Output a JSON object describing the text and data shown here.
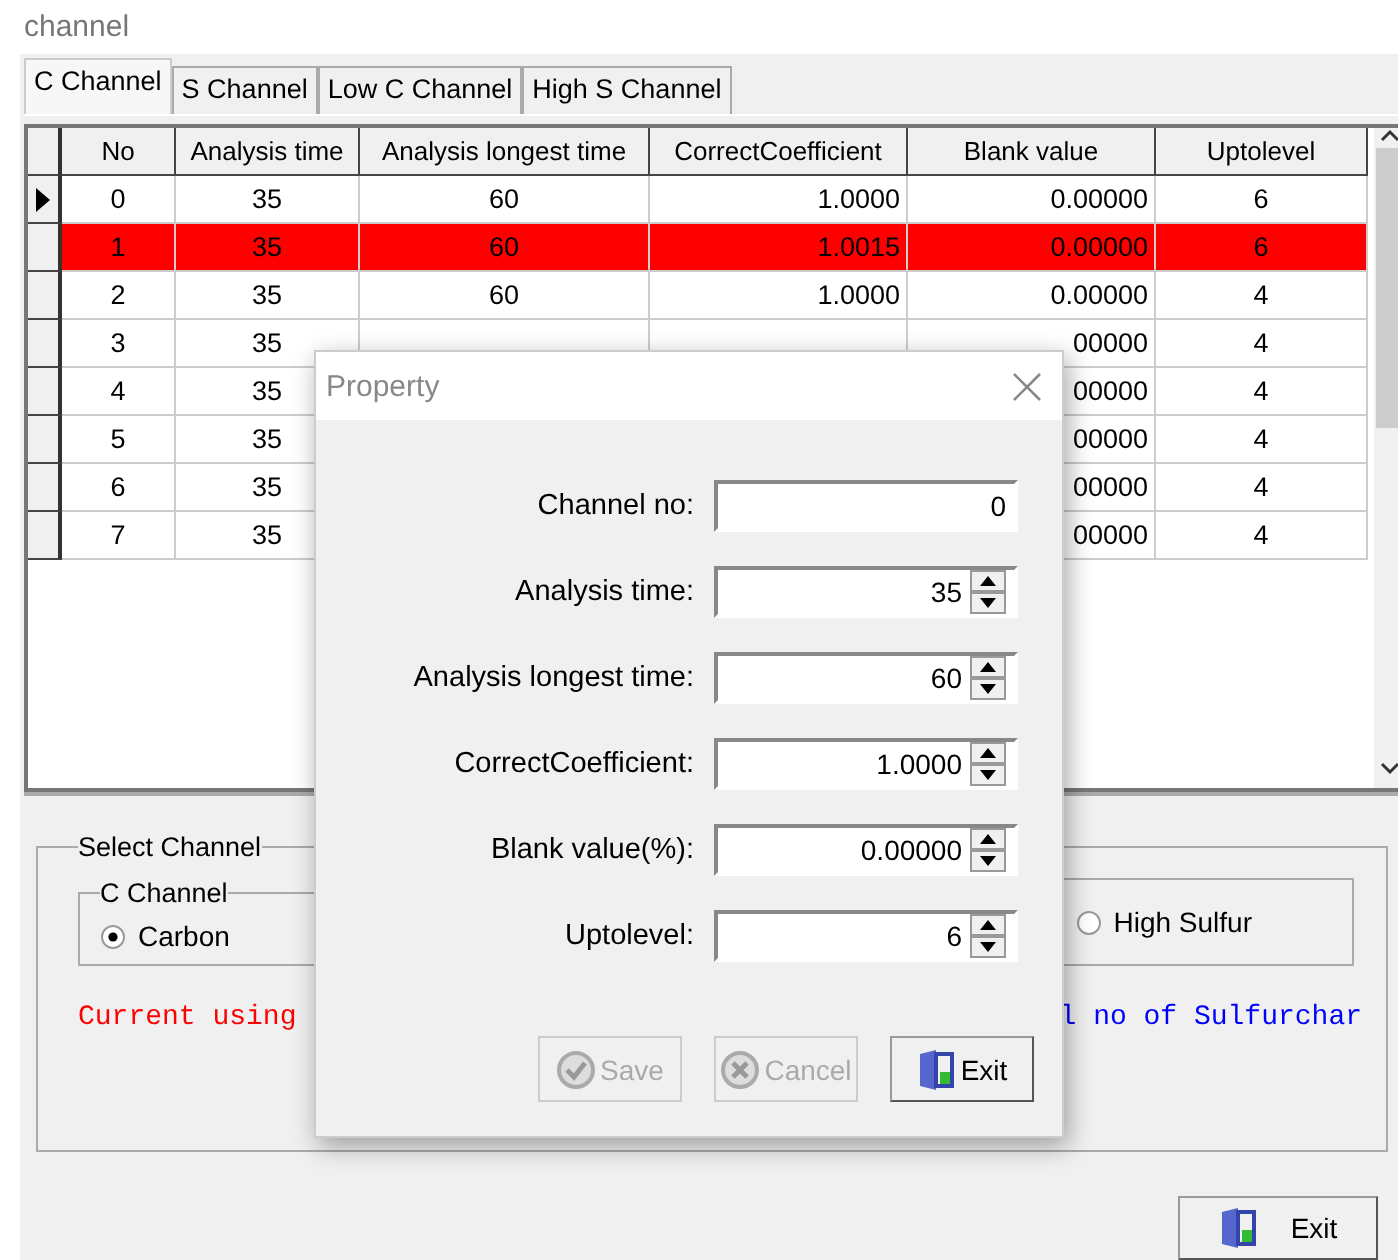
{
  "window": {
    "title": "channel"
  },
  "tabs": [
    {
      "label": "C Channel",
      "selected": true
    },
    {
      "label": "S Channel",
      "selected": false
    },
    {
      "label": "Low C Channel",
      "selected": false
    },
    {
      "label": "High S Channel",
      "selected": false
    }
  ],
  "table": {
    "columns": [
      "No",
      "Analysis time",
      "Analysis longest time",
      "CorrectCoefficient",
      "Blank value",
      "Uptolevel"
    ],
    "rows": [
      {
        "current": true,
        "highlighted": false,
        "no": "0",
        "analysis_time": "35",
        "longest_time": "60",
        "coefficient": "1.0000",
        "blank_value": "0.00000",
        "uptolevel": "6"
      },
      {
        "current": false,
        "highlighted": true,
        "no": "1",
        "analysis_time": "35",
        "longest_time": "60",
        "coefficient": "1.0015",
        "blank_value": "0.00000",
        "uptolevel": "6"
      },
      {
        "current": false,
        "highlighted": false,
        "no": "2",
        "analysis_time": "35",
        "longest_time": "60",
        "coefficient": "1.0000",
        "blank_value": "0.00000",
        "uptolevel": "4"
      },
      {
        "current": false,
        "highlighted": false,
        "no": "3",
        "analysis_time": "35",
        "blank_value": "00000",
        "uptolevel": "4"
      },
      {
        "current": false,
        "highlighted": false,
        "no": "4",
        "analysis_time": "35",
        "blank_value": "00000",
        "uptolevel": "4"
      },
      {
        "current": false,
        "highlighted": false,
        "no": "5",
        "analysis_time": "35",
        "blank_value": "00000",
        "uptolevel": "4"
      },
      {
        "current": false,
        "highlighted": false,
        "no": "6",
        "analysis_time": "35",
        "blank_value": "00000",
        "uptolevel": "4"
      },
      {
        "current": false,
        "highlighted": false,
        "no": "7",
        "analysis_time": "35",
        "blank_value": "00000",
        "uptolevel": "4"
      }
    ]
  },
  "select_channel": {
    "title": "Select Channel",
    "groups": [
      {
        "title": "C Channel",
        "options": [
          {
            "label": "Carbon",
            "selected": true
          }
        ]
      },
      {
        "options": [
          {
            "label": "High Sulfur",
            "selected": false
          }
        ]
      }
    ],
    "messages": [
      {
        "text": "Current using",
        "color": "#ff0000"
      },
      {
        "text": "l no of Sulfurchar",
        "color": "#0000ff"
      }
    ]
  },
  "exit_button": {
    "label": "Exit"
  },
  "dialog": {
    "title": "Property",
    "fields": [
      {
        "label": "Channel no:",
        "value": "0",
        "kind": "text"
      },
      {
        "label": "Analysis time:",
        "value": "35",
        "kind": "spin"
      },
      {
        "label": "Analysis longest time:",
        "value": "60",
        "kind": "spin"
      },
      {
        "label": "CorrectCoefficient:",
        "value": "1.0000",
        "kind": "spin"
      },
      {
        "label": "Blank value(%):",
        "value": "0.00000",
        "kind": "spin"
      },
      {
        "label": "Uptolevel:",
        "value": "6",
        "kind": "spin"
      }
    ],
    "buttons": [
      {
        "label": "Save",
        "kind": "save",
        "disabled": true
      },
      {
        "label": "Cancel",
        "kind": "cancel",
        "disabled": true
      },
      {
        "label": "Exit",
        "kind": "exit",
        "disabled": false
      }
    ]
  }
}
